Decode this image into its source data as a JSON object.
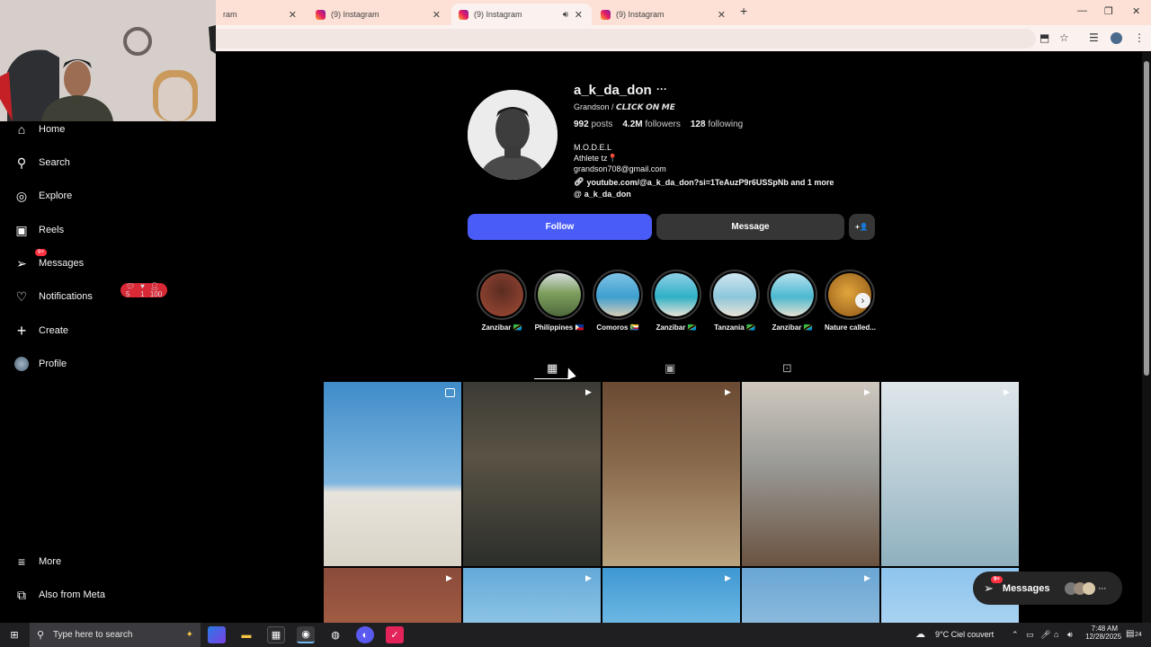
{
  "browser": {
    "tabs": [
      {
        "title": "ram",
        "active": false
      },
      {
        "title": "(9) Instagram",
        "active": false
      },
      {
        "title": "(9) Instagram",
        "active": true
      },
      {
        "title": "(9) Instagram",
        "active": false
      }
    ],
    "new_tab": "+",
    "window_controls": {
      "minimize": "—",
      "maximize": "❐",
      "close": "✕"
    }
  },
  "sidebar": {
    "items": [
      {
        "label": "Home",
        "icon": "home-icon"
      },
      {
        "label": "Search",
        "icon": "search-icon"
      },
      {
        "label": "Explore",
        "icon": "compass-icon"
      },
      {
        "label": "Reels",
        "icon": "reels-icon"
      },
      {
        "label": "Messages",
        "icon": "send-icon",
        "badge": "9+"
      },
      {
        "label": "Notifications",
        "icon": "heart-icon"
      },
      {
        "label": "Create",
        "icon": "plus-icon"
      },
      {
        "label": "Profile",
        "icon": "avatar"
      }
    ],
    "notif_pill": {
      "comments": "5",
      "likes": "1",
      "follows": "100"
    },
    "more": "More",
    "also_from_meta": "Also from Meta"
  },
  "profile": {
    "username": "a_k_da_don",
    "options": "···",
    "category_line": "Grandson / ",
    "category_emph": "𝘾𝙇𝙄𝘾𝙆 𝙊𝙉 𝙈𝙀",
    "stats": [
      {
        "value": "992",
        "label": "posts"
      },
      {
        "value": "4.2M",
        "label": "followers"
      },
      {
        "value": "128",
        "label": "following"
      }
    ],
    "bio": [
      "M.O.D.E.L",
      "Athlete tz📍",
      "grandson708@gmail.com"
    ],
    "link": "youtube.com/@a_k_da_don?si=1TeAuzP9r6USSpNb and 1 more",
    "threads": "a_k_da_don",
    "follow_label": "Follow",
    "message_label": "Message",
    "suggest_icon": "+👤"
  },
  "highlights": [
    {
      "label": "Zanzibar 🇹🇿",
      "color": "#7a3b2a"
    },
    {
      "label": "Philippines 🇵🇭",
      "color": "#5f7d4a"
    },
    {
      "label": "Comoros 🇰🇲",
      "color": "#3a8db8"
    },
    {
      "label": "Zanzibar 🇹🇿",
      "color": "#2f9bb0"
    },
    {
      "label": "Tanzania 🇹🇿",
      "color": "#7fbcd0"
    },
    {
      "label": "Zanzibar 🇹🇿",
      "color": "#46a7c2"
    },
    {
      "label": "Nature called...",
      "color": "#c98a2a"
    }
  ],
  "grid": {
    "row1": [
      {
        "bg": "linear-gradient(180deg,#3f8cc9 0%,#7fb6df 55%,#e8e4dc 60%,#d9d3c7 100%)",
        "icon": "clip"
      },
      {
        "bg": "linear-gradient(180deg,#3b3a34 0%,#5a5345 40%,#2b2e2a 100%)",
        "icon": "video"
      },
      {
        "bg": "linear-gradient(180deg,#6b4a33 0%,#8a6a4c 45%,#b9a27e 100%)",
        "icon": "video"
      },
      {
        "bg": "linear-gradient(180deg,#cfc8bf 0%,#9a9a96 45%,#6a5240 100%)",
        "icon": "video"
      },
      {
        "bg": "linear-gradient(180deg,#dfe6ea 0%,#b9cdd6 50%,#8fb0bf 100%)",
        "icon": "video"
      }
    ],
    "row2": [
      {
        "bg": "linear-gradient(180deg,#8a4b3b 0%,#a05b42 100%)",
        "icon": "video"
      },
      {
        "bg": "linear-gradient(180deg,#64a9d8 0%,#8cc3e6 100%)",
        "icon": "video"
      },
      {
        "bg": "linear-gradient(180deg,#3e98d2 0%,#6cb7e3 100%)",
        "icon": "video"
      },
      {
        "bg": "linear-gradient(180deg,#6aa6d4 0%,#8ab9dc 100%)",
        "icon": "video"
      },
      {
        "bg": "linear-gradient(180deg,#8ec4ee 0%,#a9d2f1 100%)",
        "icon": "video"
      }
    ]
  },
  "messages_popup": {
    "label": "Messages",
    "badge": "9+"
  },
  "taskbar": {
    "search_placeholder": "Type here to search",
    "weather": "9°C  Ciel couvert",
    "time": "7:48 AM",
    "date": "12/28/2025",
    "notif_count": "24"
  }
}
